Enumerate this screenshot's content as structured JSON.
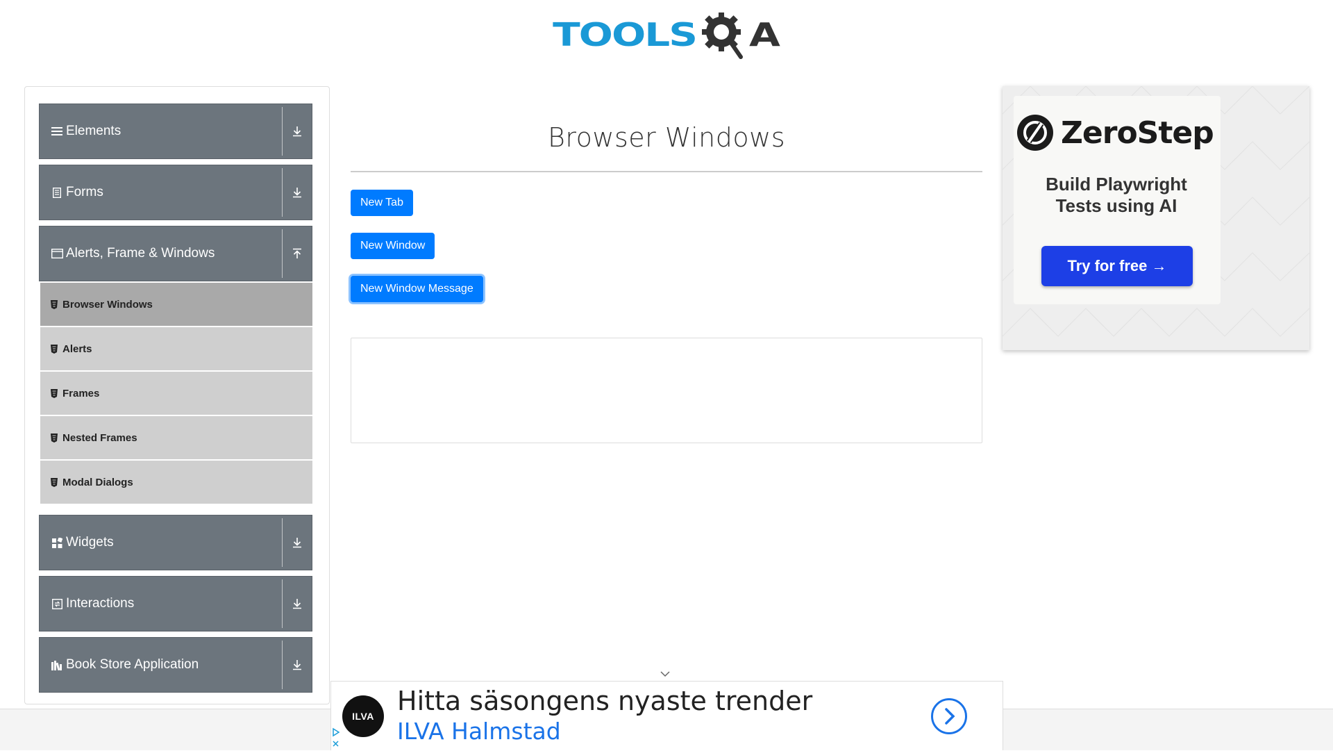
{
  "header": {
    "logo_left": "TOOLS",
    "logo_right": "A"
  },
  "sidebar": {
    "groups": [
      {
        "label": "Elements",
        "icon": "hamburger-icon",
        "arrow": "download-icon"
      },
      {
        "label": "Forms",
        "icon": "document-icon",
        "arrow": "download-icon"
      },
      {
        "label": "Alerts, Frame & Windows",
        "icon": "window-icon",
        "arrow": "upload-icon"
      },
      {
        "label": "Widgets",
        "icon": "widgets-icon",
        "arrow": "download-icon"
      },
      {
        "label": "Interactions",
        "icon": "interactions-icon",
        "arrow": "download-icon"
      },
      {
        "label": "Book Store Application",
        "icon": "books-icon",
        "arrow": "download-icon"
      }
    ],
    "items": [
      {
        "label": "Browser Windows",
        "active": true
      },
      {
        "label": "Alerts"
      },
      {
        "label": "Frames"
      },
      {
        "label": "Nested Frames"
      },
      {
        "label": "Modal Dialogs"
      }
    ]
  },
  "main": {
    "title": "Browser Windows",
    "buttons": [
      "New Tab",
      "New Window",
      "New Window Message"
    ]
  },
  "ad_right": {
    "brand": "ZeroStep",
    "tagline_1": "Build Playwright",
    "tagline_2": "Tests using AI",
    "cta": "Try for free →"
  },
  "ad_bottom": {
    "logo": "ILVA",
    "headline": "Hitta säsongens nyaste trender",
    "advertiser": "ILVA Halmstad"
  },
  "colors": {
    "primary": "#007bff",
    "sidebar_group": "#6c757d",
    "sidebar_item": "#cfcfcf",
    "sidebar_active": "#a9a9a9",
    "logo_blue": "#1a99d6",
    "zerostep_blue": "#1d3fe6"
  }
}
